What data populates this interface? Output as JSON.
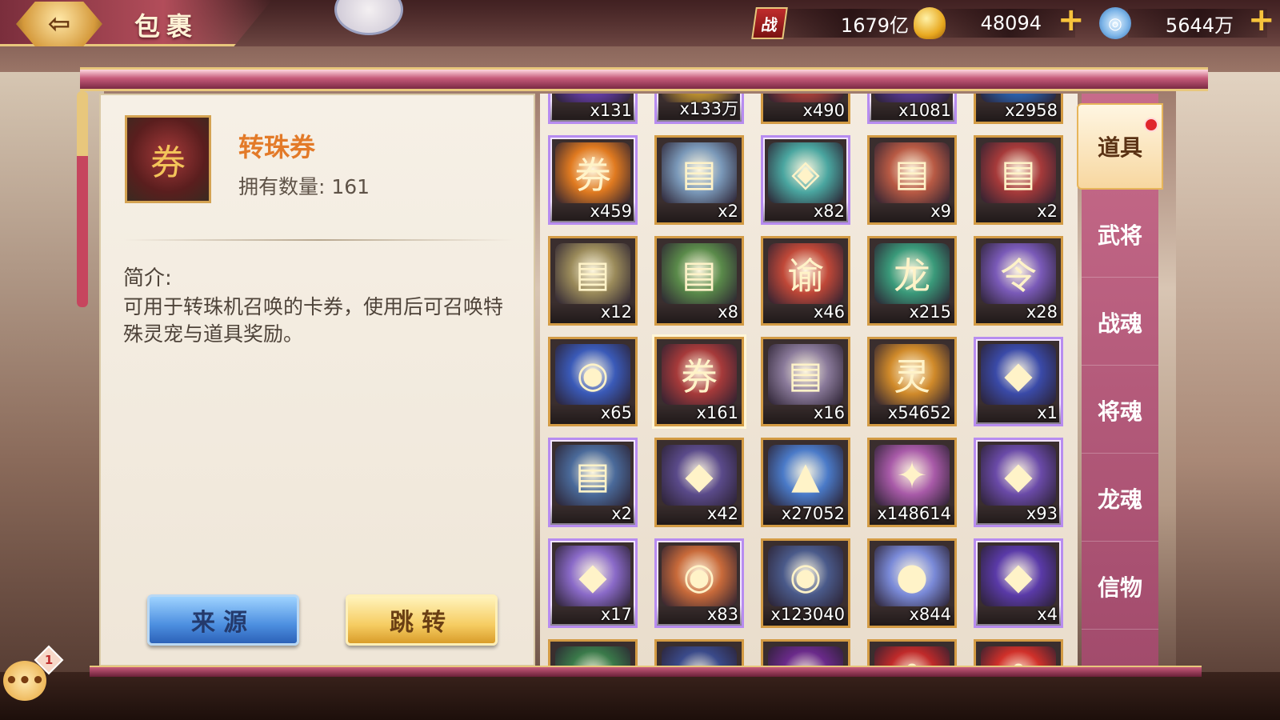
{
  "header": {
    "title": "包裹",
    "back_glyph": "⇦",
    "resources": [
      {
        "icon": "battle-power-icon",
        "glyph": "战",
        "value": "1679亿",
        "addable": false
      },
      {
        "icon": "gold-ingot-icon",
        "glyph": "",
        "value": "48094",
        "addable": true
      },
      {
        "icon": "jade-coin-icon",
        "glyph": "◎",
        "value": "5644万",
        "addable": true
      }
    ],
    "plus": "+"
  },
  "detail": {
    "item_name": "转珠券",
    "count_text": "拥有数量: 161",
    "desc_heading": "简介:",
    "description": "可用于转珠机召唤的卡券，使用后可召唤特殊灵宠与道具奖励。",
    "btn_source": "来源",
    "btn_jump": "跳转"
  },
  "items": [
    {
      "qty": "x131",
      "icon": "purple-gem-icon",
      "glyph": "◆",
      "color": "#6a3fb0",
      "frame": "purple"
    },
    {
      "qty": "x133万",
      "icon": "gold-ingot-icon",
      "glyph": "●",
      "color": "#c99a2e",
      "frame": "purple"
    },
    {
      "qty": "x490",
      "icon": "red-orb-icon",
      "glyph": "●",
      "color": "#b2423a",
      "frame": "gold"
    },
    {
      "qty": "x1081",
      "icon": "violet-crystal-icon",
      "glyph": "◆",
      "color": "#5a3a9a",
      "frame": "purple"
    },
    {
      "qty": "x2958",
      "icon": "blue-crystal-icon",
      "glyph": "◆",
      "color": "#2a66b8",
      "frame": "gold"
    },
    {
      "qty": "x459",
      "icon": "gold-scroll-icon",
      "glyph": "券",
      "color": "#e07a20",
      "frame": "purple"
    },
    {
      "qty": "x2",
      "icon": "scroll-icon",
      "glyph": "▤",
      "color": "#7a98b8",
      "frame": "gold"
    },
    {
      "qty": "x82",
      "icon": "jade-pendant-icon",
      "glyph": "◈",
      "color": "#4aa6a0",
      "frame": "purple"
    },
    {
      "qty": "x9",
      "icon": "scroll-icon",
      "glyph": "▤",
      "color": "#b85a44",
      "frame": "gold"
    },
    {
      "qty": "x2",
      "icon": "red-scroll-icon",
      "glyph": "▤",
      "color": "#a63a3a",
      "frame": "gold"
    },
    {
      "qty": "x12",
      "icon": "scroll-icon",
      "glyph": "▤",
      "color": "#9a8a5a",
      "frame": "gold"
    },
    {
      "qty": "x8",
      "icon": "green-scroll-icon",
      "glyph": "▤",
      "color": "#5a8a4a",
      "frame": "gold"
    },
    {
      "qty": "x46",
      "icon": "imperial-edict-icon",
      "glyph": "谕",
      "color": "#c04838",
      "frame": "gold"
    },
    {
      "qty": "x215",
      "icon": "dragon-card-icon",
      "glyph": "龙",
      "color": "#3a9a7a",
      "frame": "gold"
    },
    {
      "qty": "x28",
      "icon": "command-token-icon",
      "glyph": "令",
      "color": "#7a5ab8",
      "frame": "gold"
    },
    {
      "qty": "x65",
      "icon": "celestial-orb-icon",
      "glyph": "◉",
      "color": "#3a5ab8",
      "frame": "gold"
    },
    {
      "qty": "x161",
      "icon": "bead-ticket-icon",
      "glyph": "券",
      "color": "#a63a3a",
      "frame": "gold",
      "selected": true
    },
    {
      "qty": "x16",
      "icon": "scroll-icon",
      "glyph": "▤",
      "color": "#8a7a9a",
      "frame": "gold"
    },
    {
      "qty": "x54652",
      "icon": "spirit-stone-icon",
      "glyph": "灵",
      "color": "#d08a2a",
      "frame": "gold"
    },
    {
      "qty": "x1",
      "icon": "soul-crystal-icon",
      "glyph": "◆",
      "color": "#3a4aa8",
      "frame": "purple"
    },
    {
      "qty": "x2",
      "icon": "magic-scroll-icon",
      "glyph": "▤",
      "color": "#4a6a9a",
      "frame": "purple"
    },
    {
      "qty": "x42",
      "icon": "dark-crystal-icon",
      "glyph": "◆",
      "color": "#5a4a8a",
      "frame": "gold"
    },
    {
      "qty": "x27052",
      "icon": "crystal-pile-icon",
      "glyph": "▲",
      "color": "#4a7ac8",
      "frame": "gold"
    },
    {
      "qty": "x148614",
      "icon": "stardust-icon",
      "glyph": "✦",
      "color": "#a85aa8",
      "frame": "gold"
    },
    {
      "qty": "x93",
      "icon": "void-crystal-icon",
      "glyph": "◆",
      "color": "#6a4aa8",
      "frame": "purple"
    },
    {
      "qty": "x17",
      "icon": "prism-gem-icon",
      "glyph": "◆",
      "color": "#8a6ac8",
      "frame": "purple"
    },
    {
      "qty": "x83",
      "icon": "fire-orb-icon",
      "glyph": "◉",
      "color": "#c86a3a",
      "frame": "purple"
    },
    {
      "qty": "x123040",
      "icon": "dancer-orb-icon",
      "glyph": "◉",
      "color": "#4a5a8a",
      "frame": "gold"
    },
    {
      "qty": "x844",
      "icon": "rainbow-pearl-icon",
      "glyph": "●",
      "color": "#7a8ad8",
      "frame": "gold"
    },
    {
      "qty": "x4",
      "icon": "spirit-crystal-icon",
      "glyph": "◆",
      "color": "#5a3aa8",
      "frame": "purple"
    },
    {
      "qty": "",
      "icon": "green-orb-icon",
      "glyph": "●",
      "color": "#3a7a4a",
      "frame": "gold"
    },
    {
      "qty": "",
      "icon": "blue-orb-icon",
      "glyph": "●",
      "color": "#3a4a8a",
      "frame": "gold"
    },
    {
      "qty": "",
      "icon": "purple-orb-icon",
      "glyph": "●",
      "color": "#6a2a8a",
      "frame": "gold"
    },
    {
      "qty": "",
      "icon": "red-flower-icon",
      "glyph": "✿",
      "color": "#c02a2a",
      "frame": "gold"
    },
    {
      "qty": "",
      "icon": "red-flower-icon",
      "glyph": "✿",
      "color": "#d0302a",
      "frame": "gold"
    }
  ],
  "tabs": [
    {
      "label": "道具",
      "active": true,
      "badge": true
    },
    {
      "label": "武将"
    },
    {
      "label": "战魂"
    },
    {
      "label": "将魂"
    },
    {
      "label": "龙魂"
    },
    {
      "label": "信物"
    }
  ],
  "chat": {
    "glyph": "•••",
    "badge": "1"
  }
}
